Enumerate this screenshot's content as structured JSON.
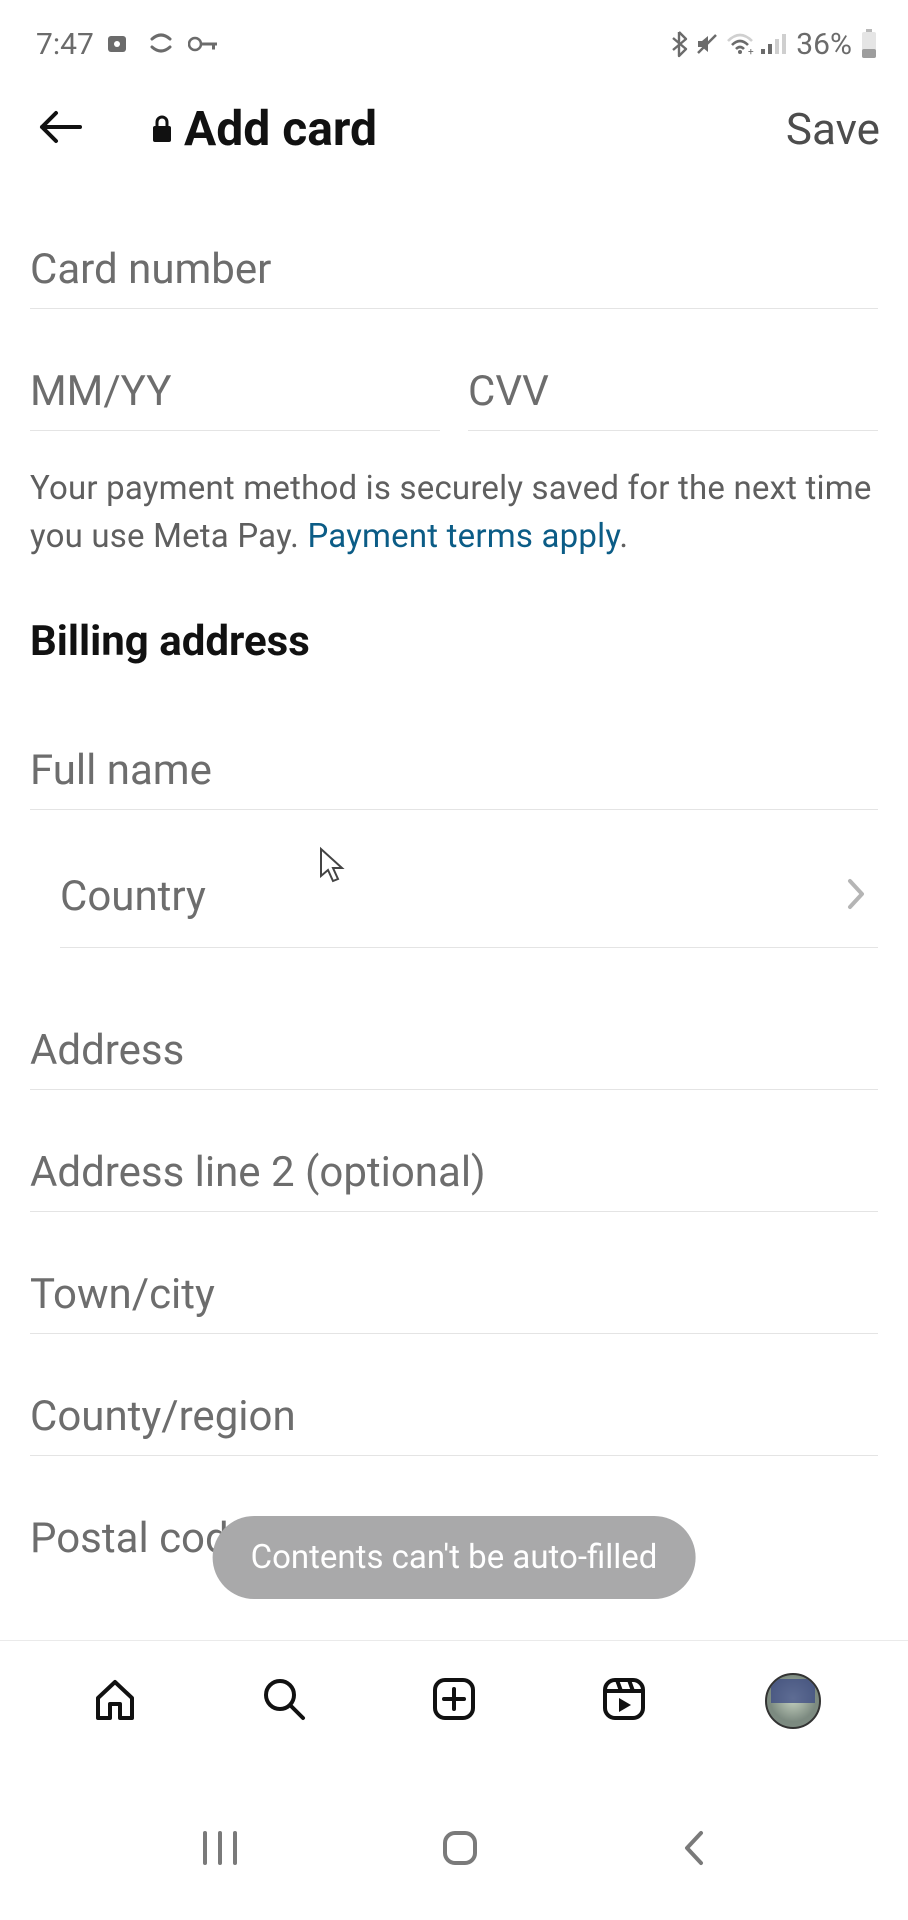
{
  "statusbar": {
    "time": "7:47",
    "battery": "36%"
  },
  "header": {
    "title": "Add card",
    "save": "Save"
  },
  "placeholders": {
    "card_number": "Card number",
    "expiry": "MM/YY",
    "cvv": "CVV",
    "full_name": "Full name",
    "country": "Country",
    "address": "Address",
    "address2": "Address line 2 (optional)",
    "town": "Town/city",
    "county": "County/region",
    "postal": "Postal code"
  },
  "info": {
    "text_pre": "Your payment method is securely saved for the next time you use Meta Pay. ",
    "link": "Payment terms apply",
    "period": "."
  },
  "section": {
    "billing": "Billing address"
  },
  "toast": "Contents can't be auto-filled"
}
